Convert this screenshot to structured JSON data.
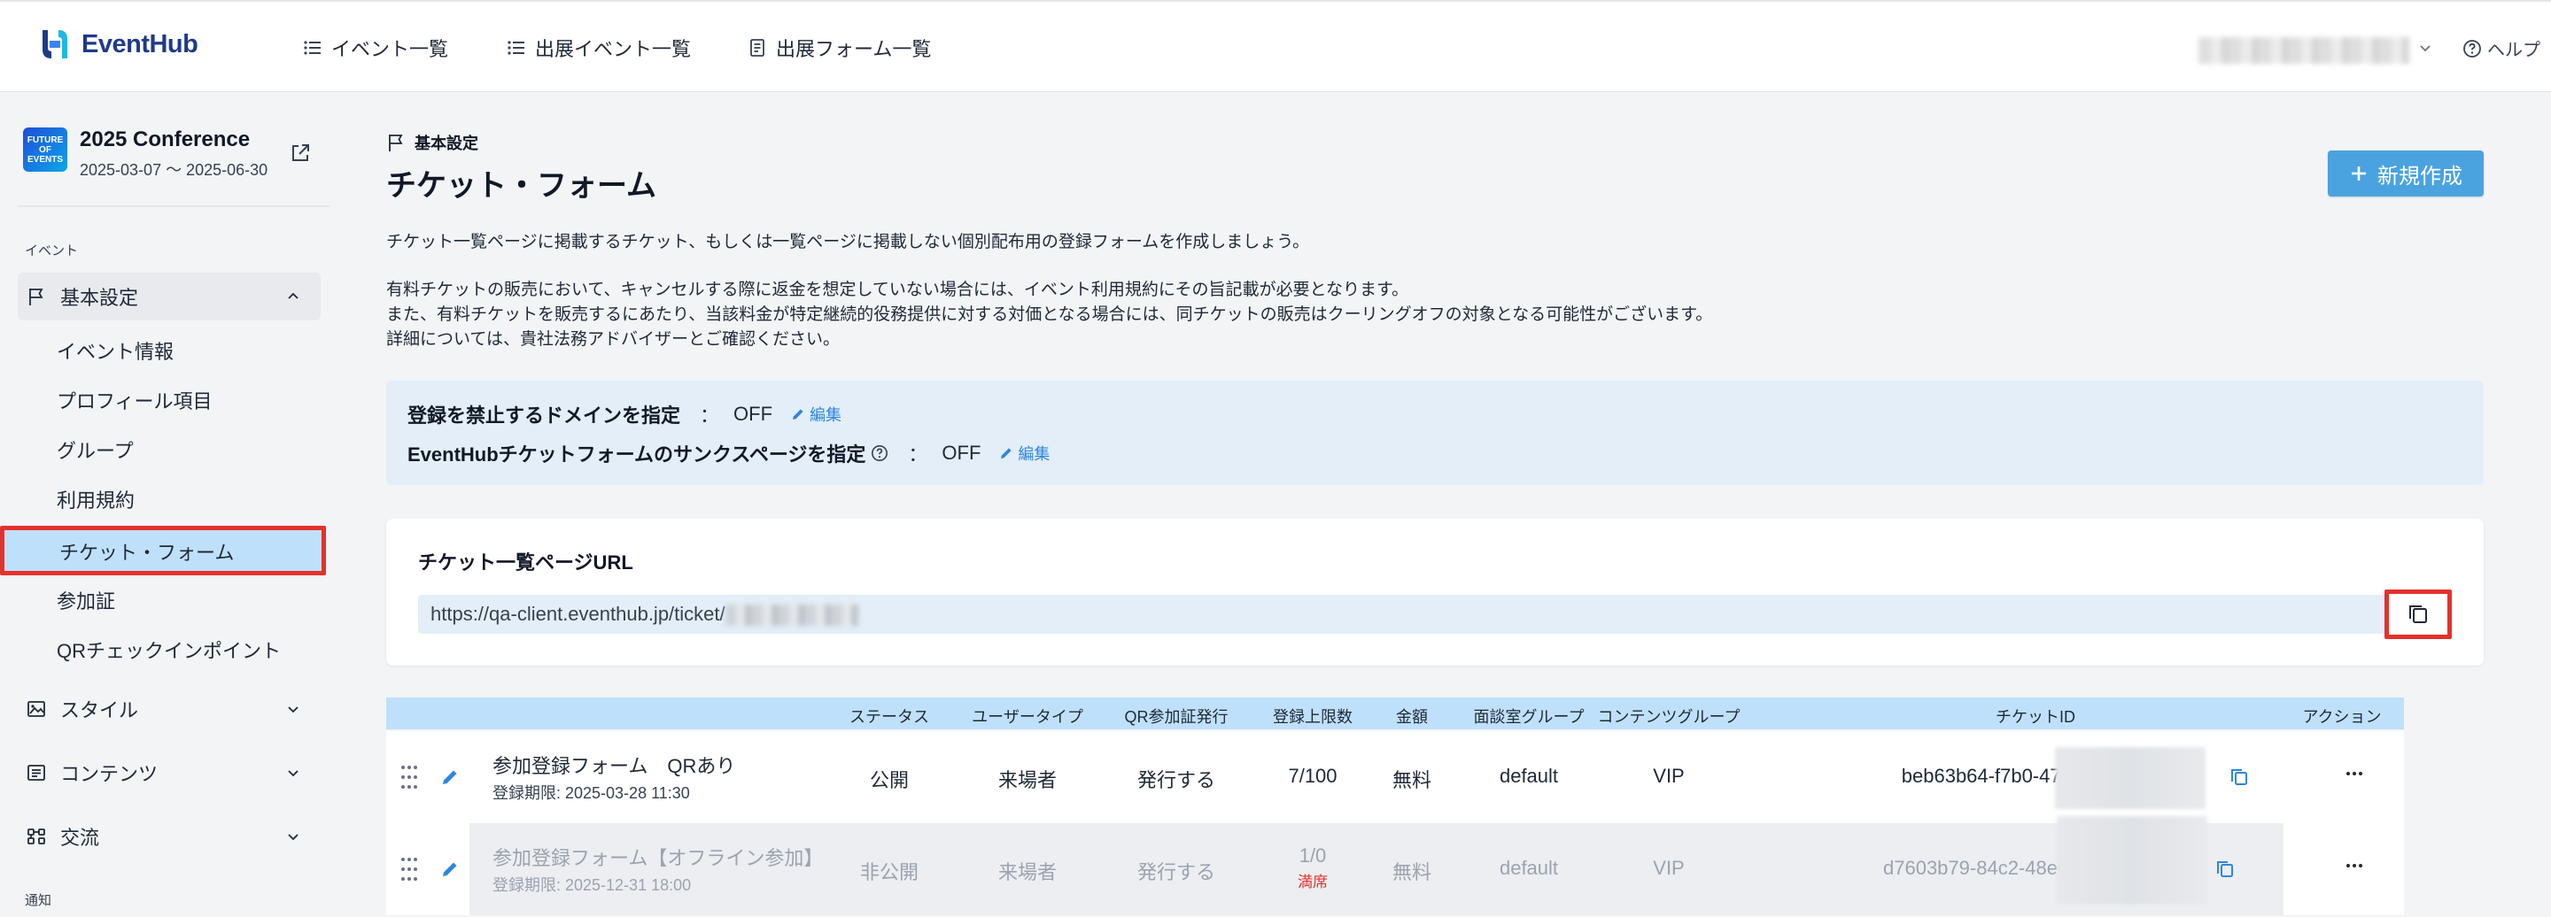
{
  "header": {
    "brand": "EventHub",
    "nav": [
      {
        "label": "イベント一覧",
        "icon": "list-icon"
      },
      {
        "label": "出展イベント一覧",
        "icon": "list-icon"
      },
      {
        "label": "出展フォーム一覧",
        "icon": "form-icon"
      }
    ],
    "help_label": "ヘルプ"
  },
  "sidebar": {
    "conference": {
      "badge": "FUTURE OF EVENTS",
      "title": "2025 Conference",
      "dates": "2025-03-07 ～ 2025-06-30"
    },
    "section_event": "イベント",
    "groups": [
      {
        "label": "基本設定",
        "icon": "flag-icon",
        "expanded": true
      },
      {
        "label": "スタイル",
        "icon": "image-icon",
        "expanded": false
      },
      {
        "label": "コンテンツ",
        "icon": "content-icon",
        "expanded": false
      },
      {
        "label": "交流",
        "icon": "network-icon",
        "expanded": false
      }
    ],
    "sub_items": [
      "イベント情報",
      "プロフィール項目",
      "グループ",
      "利用規約",
      "チケット・フォーム",
      "参加証",
      "QRチェックインポイント"
    ],
    "selected_item": "チケット・フォーム",
    "section_notify": "通知"
  },
  "main": {
    "breadcrumb": "基本設定",
    "title": "チケット・フォーム",
    "new_button": "新規作成",
    "description": [
      "チケット一覧ページに掲載するチケット、もしくは一覧ページに掲載しない個別配布用の登録フォームを作成しましょう。",
      "有料チケットの販売において、キャンセルする際に返金を想定していない場合には、イベント利用規約にその旨記載が必要となります。",
      "また、有料チケットを販売するにあたり、当該料金が特定継続的役務提供に対する対価となる場合には、同チケットの販売はクーリングオフの対象となる可能性がございます。",
      "詳細については、貴社法務アドバイザーとご確認ください。"
    ],
    "settings": {
      "domain_label": "登録を禁止するドメインを指定",
      "domain_value": "OFF",
      "thanks_label": "EventHubチケットフォームのサンクスページを指定",
      "thanks_value": "OFF",
      "colon": "：",
      "edit_label": "編集"
    },
    "url_card": {
      "title": "チケット一覧ページURL",
      "url": "https://qa-client.eventhub.jp/ticket/"
    },
    "table": {
      "columns": [
        "ステータス",
        "ユーザータイプ",
        "QR参加証発行",
        "登録上限数",
        "金額",
        "面談室グループ",
        "コンテンツグループ",
        "チケットID",
        "アクション"
      ],
      "rows": [
        {
          "name": "参加登録フォーム　QRあり",
          "period": "登録期限: 2025-03-28 11:30",
          "status": "公開",
          "user_type": "来場者",
          "qr": "発行する",
          "limit": "7/100",
          "sold_out": "",
          "price": "無料",
          "room_group": "default",
          "content_group": "VIP",
          "ticket_id": "beb63b64-f7b0-4743-bf93"
        },
        {
          "name": "参加登録フォーム【オフライン参加】",
          "period": "登録期限: 2025-12-31 18:00",
          "status": "非公開",
          "user_type": "来場者",
          "qr": "発行する",
          "limit": "1/0",
          "sold_out": "満席",
          "price": "無料",
          "room_group": "default",
          "content_group": "VIP",
          "ticket_id": "d7603b79-84c2-48e0-88c"
        }
      ]
    }
  },
  "colors": {
    "brand": "#1f3a8a",
    "accent_button": "#4aa3df",
    "link": "#2e86de",
    "highlight_border": "#e5312b",
    "selected_bg": "#bfe0fb",
    "panel_bg": "#e3eef8"
  }
}
